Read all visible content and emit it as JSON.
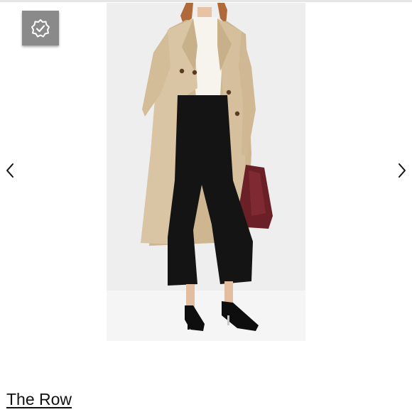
{
  "listing": {
    "brand_name": "The Row"
  },
  "badge": {
    "icon": "verified-check-icon",
    "background": "#8a8a8a"
  },
  "carousel": {
    "prev_icon": "chevron-left-icon",
    "next_icon": "chevron-right-icon"
  },
  "colors": {
    "coat": "#d9c4a3",
    "trousers": "#141414",
    "bag": "#6b1f26",
    "backdrop": "#eeeeee"
  }
}
